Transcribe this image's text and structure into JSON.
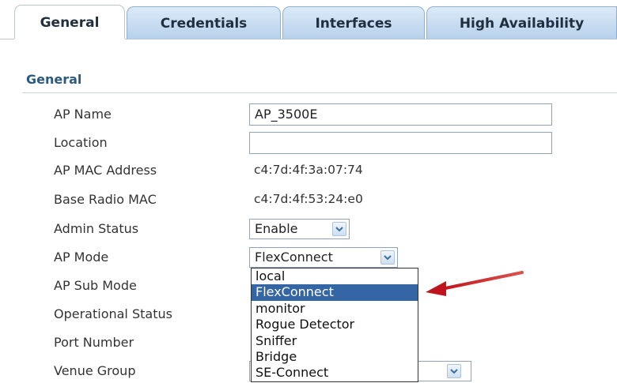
{
  "tabs": [
    {
      "label": "General",
      "active": true
    },
    {
      "label": "Credentials",
      "active": false
    },
    {
      "label": "Interfaces",
      "active": false
    },
    {
      "label": "High Availability",
      "active": false
    }
  ],
  "section": {
    "title": "General"
  },
  "fields": {
    "ap_name": {
      "label": "AP Name",
      "value": "AP_3500E"
    },
    "location": {
      "label": "Location",
      "value": ""
    },
    "ap_mac": {
      "label": "AP MAC Address",
      "value": "c4:7d:4f:3a:07:74"
    },
    "base_radio_mac": {
      "label": "Base Radio MAC",
      "value": "c4:7d:4f:53:24:e0"
    },
    "admin_status": {
      "label": "Admin Status",
      "value": "Enable"
    },
    "ap_mode": {
      "label": "AP Mode",
      "value": "FlexConnect"
    },
    "ap_sub_mode": {
      "label": "AP Sub Mode"
    },
    "operational_status": {
      "label": "Operational Status"
    },
    "port_number": {
      "label": "Port Number"
    },
    "venue_group": {
      "label": "Venue Group"
    }
  },
  "ap_mode_options": [
    "local",
    "FlexConnect",
    "monitor",
    "Rogue Detector",
    "Sniffer",
    "Bridge",
    "SE-Connect"
  ],
  "ap_mode_highlighted": "FlexConnect",
  "colors": {
    "highlight": "#3465a4",
    "arrow": "#c0141c",
    "section_title": "#2c5a7e",
    "tab": "#c4dbf1"
  },
  "icons": {
    "dropdown": "chevron-down-icon",
    "annotation": "red-arrow"
  }
}
